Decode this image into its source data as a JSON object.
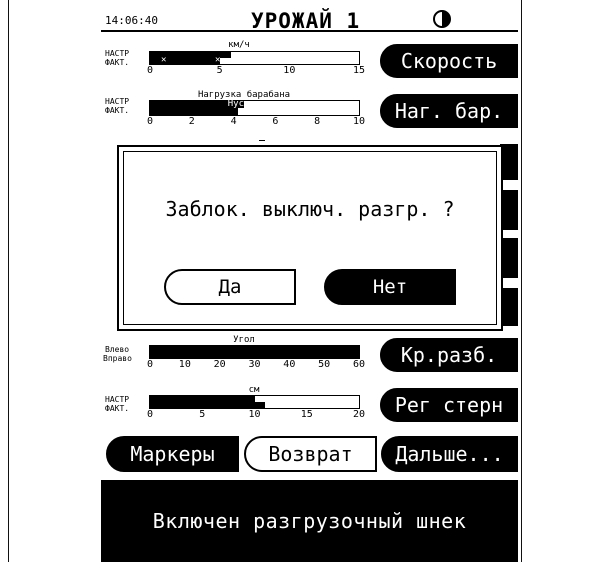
{
  "header": {
    "time": "14:06:40",
    "title": "УРОЖАЙ 1"
  },
  "speed_gauge": {
    "title": "км/ч",
    "row_labels": [
      "НАСТР",
      "ФАКТ."
    ],
    "ticks": [
      "0",
      "5",
      "10",
      "15"
    ],
    "max": 15,
    "setpoint": 5.8,
    "actual": 5.0,
    "button": "Скорость"
  },
  "drum_gauge": {
    "title": "Нагрузка барабана",
    "row_labels": [
      "НАСТР",
      "ФАКТ."
    ],
    "ticks": [
      "0",
      "2",
      "4",
      "6",
      "8",
      "10"
    ],
    "max": 10,
    "setpoint": 4.5,
    "actual": 4.2,
    "overlay_text": "Нусшел",
    "button": "Наг. бар."
  },
  "dialog": {
    "question": "Заблок. выключ. разгр. ?",
    "yes": "Да",
    "no": "Нет"
  },
  "angle_gauge": {
    "title": "Угол",
    "row_labels": [
      "Влево",
      "Вправо"
    ],
    "ticks": [
      "0",
      "10",
      "20",
      "30",
      "40",
      "50",
      "60"
    ],
    "max": 60,
    "left_value": 60,
    "right_value": 60,
    "button": "Кр.разб."
  },
  "stubble_gauge": {
    "title": "см",
    "row_labels": [
      "НАСТР",
      "ФАКТ."
    ],
    "ticks": [
      "0",
      "5",
      "10",
      "15",
      "20"
    ],
    "max": 20,
    "setpoint": 10,
    "actual": 11,
    "button": "Рег стерн"
  },
  "bottom_buttons": {
    "markers": "Маркеры",
    "back": "Возврат",
    "next": "Дальше..."
  },
  "status": {
    "message": "Включен разгрузочный шнек"
  }
}
